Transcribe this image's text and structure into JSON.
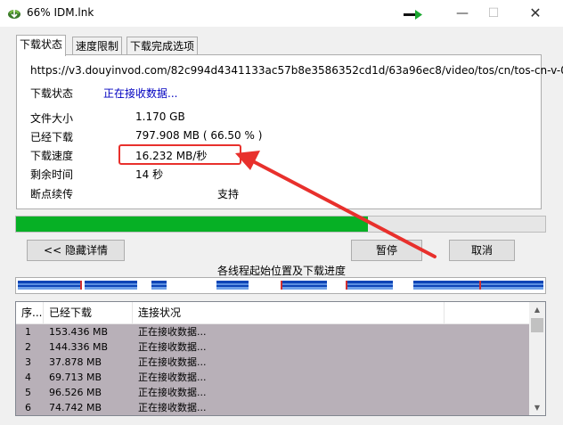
{
  "window": {
    "title": "66% IDM.lnk",
    "minimize_glyph": "—",
    "maximize_glyph": "☐",
    "close_glyph": "✕"
  },
  "tabs": [
    {
      "label": "下载状态"
    },
    {
      "label": "速度限制"
    },
    {
      "label": "下载完成选项"
    }
  ],
  "info": {
    "url": "https://v3.douyinvod.com/82c994d4341133ac57b8e3586352cd1d/63a96ec8/video/tos/cn/tos-cn-v-0",
    "status_label": "下载状态",
    "status_value": "正在接收数据...",
    "size_label": "文件大小",
    "size_value": "1.170  GB",
    "downloaded_label": "已经下载",
    "downloaded_value": "797.908  MB ( 66.50 % )",
    "speed_label": "下载速度",
    "speed_value": "16.232  MB/秒",
    "remaining_label": "剩余时间",
    "remaining_value": "14 秒",
    "resume_label": "断点续传",
    "resume_value": "支持"
  },
  "progress": {
    "percent": 66.5
  },
  "buttons": {
    "hide_details": "<< 隐藏详情",
    "pause": "暂停",
    "cancel": "取消"
  },
  "threads_label": "各线程起始位置及下载进度",
  "thread_list": {
    "columns": [
      "序...",
      "已经下载",
      "连接状况",
      ""
    ],
    "rows": [
      {
        "id": "1",
        "downloaded": "153.436  MB",
        "status": "正在接收数据..."
      },
      {
        "id": "2",
        "downloaded": "144.336  MB",
        "status": "正在接收数据..."
      },
      {
        "id": "3",
        "downloaded": "37.878  MB",
        "status": "正在接收数据..."
      },
      {
        "id": "4",
        "downloaded": "69.713  MB",
        "status": "正在接收数据..."
      },
      {
        "id": "5",
        "downloaded": "96.526  MB",
        "status": "正在接收数据..."
      },
      {
        "id": "6",
        "downloaded": "74.742  MB",
        "status": "正在接收数据..."
      }
    ]
  },
  "colors": {
    "progress_fill": "#06b025",
    "annotation": "#e8302c",
    "status_text": "#0000c0"
  },
  "icons": {
    "app": "idm-app-icon",
    "arrow": "green-arrow-icon"
  }
}
